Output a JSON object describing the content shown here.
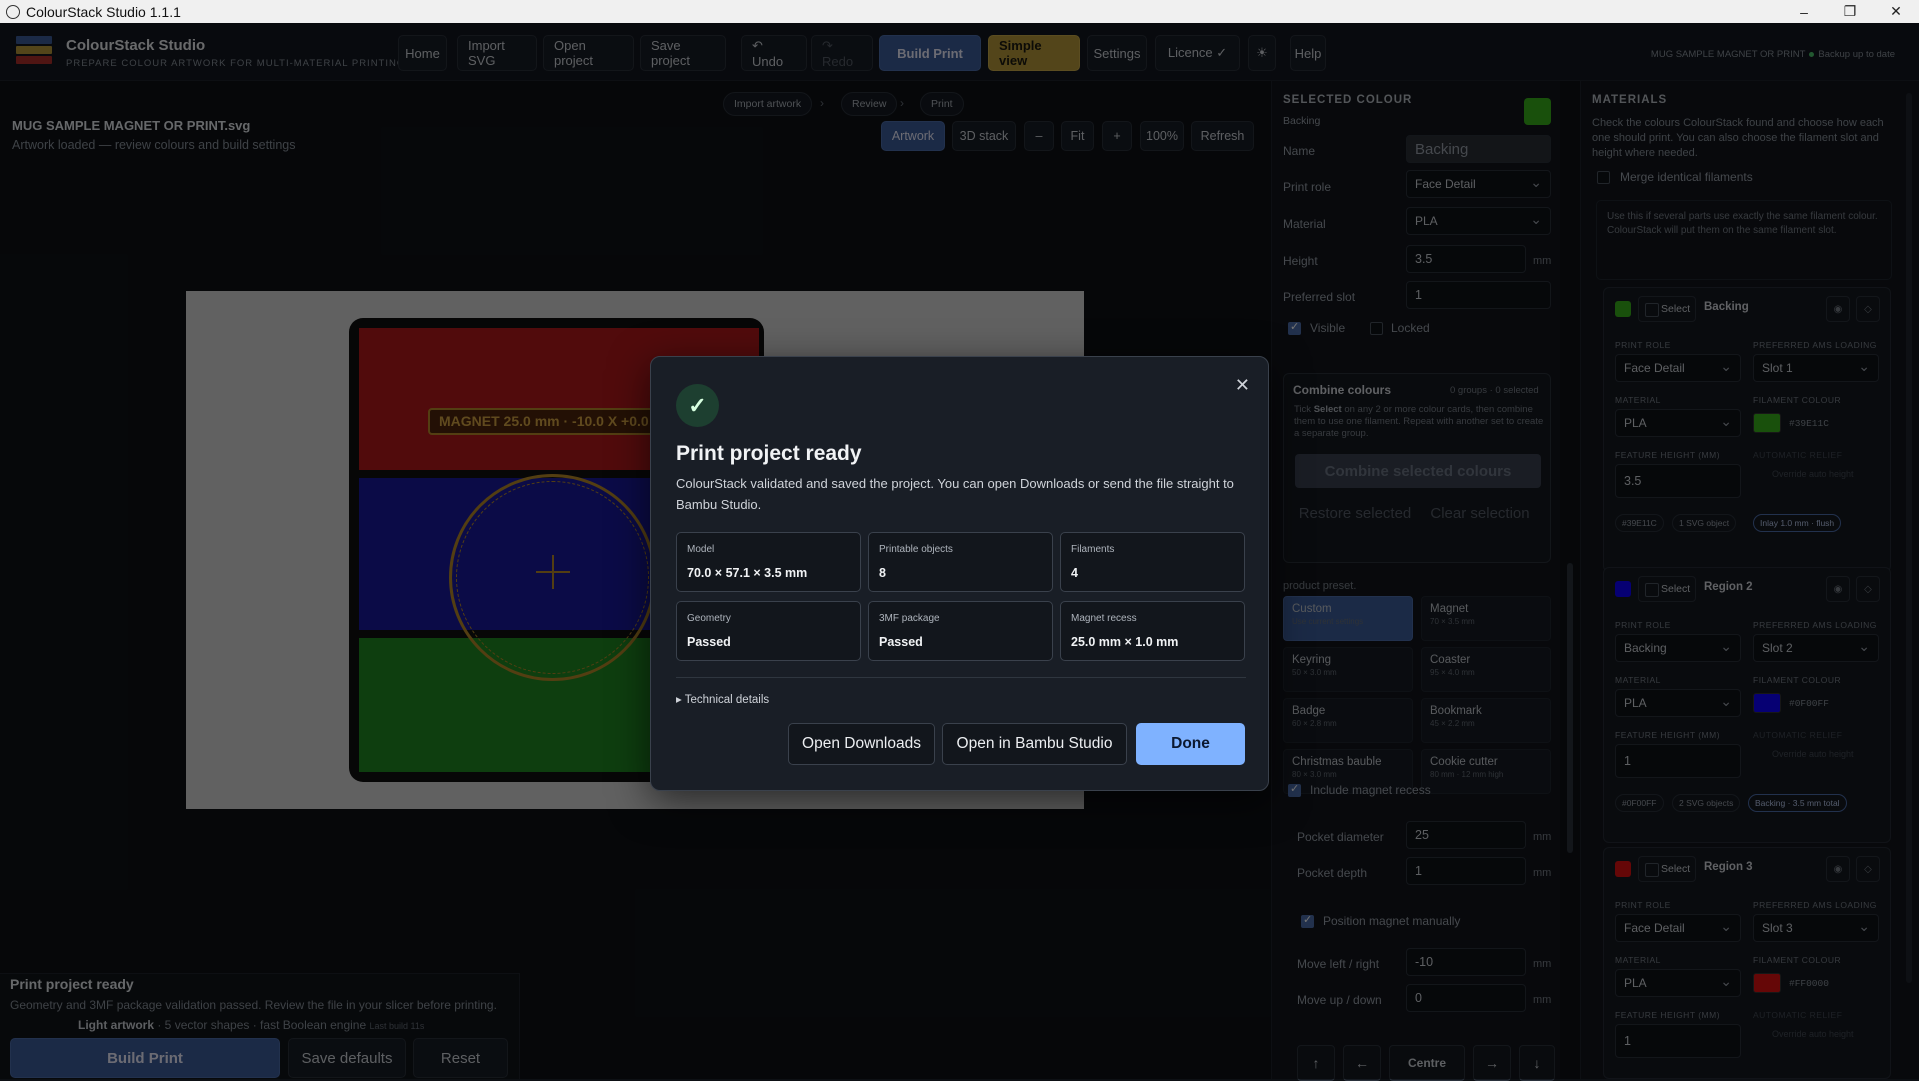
{
  "window": {
    "title": "ColourStack Studio 1.1.1",
    "minimize": "–",
    "maximize": "❐",
    "close": "✕"
  },
  "brand": {
    "name": "ColourStack Studio",
    "tagline": "PREPARE COLOUR ARTWORK FOR MULTI-MATERIAL PRINTING",
    "logo_colors": [
      "#3d5e9b",
      "#b89a3b",
      "#b0302b"
    ]
  },
  "toolbar": {
    "home": "Home",
    "import_svg": "Import SVG",
    "open_project": "Open project",
    "save_project": "Save project",
    "undo": "↶ Undo",
    "redo": "↷ Redo",
    "build_print": "Build Print",
    "simple_view": "Simple view",
    "settings": "Settings",
    "licence": "Licence ✓",
    "theme": "☀",
    "help": "Help",
    "status_file": "MUG SAMPLE MAGNET OR PRINT",
    "status_backup": "Backup up to date"
  },
  "steps": {
    "import": "Import artwork",
    "review": "Review",
    "print": "Print",
    "sep": "›"
  },
  "file": {
    "name": "MUG SAMPLE MAGNET OR PRINT.svg",
    "status": "Artwork loaded — review colours and build settings"
  },
  "view": {
    "artwork": "Artwork",
    "stack3d": "3D stack",
    "minus": "–",
    "fit": "Fit",
    "plus": "+",
    "zoom": "100%",
    "refresh": "Refresh"
  },
  "canvas": {
    "magnet_label": "MAGNET 25.0 mm · -10.0 X  +0.0 Y",
    "bands": [
      "#b3191c",
      "#1a1a9e",
      "#1f8a22"
    ]
  },
  "bottom": {
    "title": "Print project ready",
    "sub": "Geometry and 3MF package validation passed. Review the file in your slicer before printing.",
    "meta_bold": "Light artwork",
    "meta": " · 5 vector shapes · fast Boolean engine",
    "meta_small": "Last build 11s",
    "build": "Build Print",
    "save_defaults": "Save defaults",
    "reset": "Reset"
  },
  "selected": {
    "header": "SELECTED COLOUR",
    "sub": "Backing",
    "swatch": "#39b11c",
    "name_label": "Name",
    "name_value": "Backing",
    "role_label": "Print role",
    "role_value": "Face Detail",
    "material_label": "Material",
    "material_value": "PLA",
    "height_label": "Height",
    "height_value": "3.5",
    "unit_mm": "mm",
    "slot_label": "Preferred slot",
    "slot_value": "1",
    "visible": "Visible",
    "locked": "Locked",
    "combine_title": "Combine colours",
    "combine_count": "0 groups · 0 selected",
    "combine_help_pre": "Tick ",
    "combine_help_bold": "Select",
    "combine_help_post": " on any 2 or more colour cards, then combine them to use one filament. Repeat with another set to create a separate group.",
    "combine_btn": "Combine selected colours",
    "restore": "Restore selected",
    "clear": "Clear selection",
    "preset_hint": "product preset.",
    "presets": [
      {
        "name": "Custom",
        "sub": "Use current settings"
      },
      {
        "name": "Magnet",
        "sub": "70 × 3.5 mm"
      },
      {
        "name": "Keyring",
        "sub": "50 × 3.0 mm"
      },
      {
        "name": "Coaster",
        "sub": "95 × 4.0 mm"
      },
      {
        "name": "Badge",
        "sub": "60 × 2.8 mm"
      },
      {
        "name": "Bookmark",
        "sub": "45 × 2.2 mm"
      },
      {
        "name": "Christmas bauble",
        "sub": "80 × 3.0 mm"
      },
      {
        "name": "Cookie cutter",
        "sub": "80 mm · 12 mm high"
      }
    ],
    "include_magnet": "Include magnet recess",
    "pocket_diam_label": "Pocket diameter",
    "pocket_diam": "25",
    "pocket_depth_label": "Pocket depth",
    "pocket_depth": "1",
    "pos_manual": "Position magnet manually",
    "move_lr_label": "Move left / right",
    "move_lr": "-10",
    "move_ud_label": "Move up / down",
    "move_ud": "0",
    "arrows": {
      "up": "↑",
      "left": "←",
      "centre": "Centre",
      "right": "→",
      "down": "↓"
    }
  },
  "materials": {
    "header": "MATERIALS",
    "help": "Check the colours ColourStack found and choose how each one should print. You can also choose the filament slot and height where needed.",
    "merge": "Merge identical filaments",
    "merge_help": "Use this if several parts use exactly the same filament colour. ColourStack will put them on the same filament slot.",
    "labels": {
      "role": "PRINT ROLE",
      "ams": "PREFERRED AMS LOADING",
      "material": "MATERIAL",
      "fcolour": "FILAMENT COLOUR",
      "feature": "FEATURE HEIGHT (MM)",
      "relief": "AUTOMATIC RELIEF",
      "override": "Override auto height",
      "select": "Select"
    },
    "cards": [
      {
        "swatch": "#39b11c",
        "name": "Backing",
        "role": "Face Detail",
        "slot": "Slot 1",
        "material": "PLA",
        "hex": "#39E11C",
        "height": "3.5",
        "pills": [
          "#39E11C",
          "1 SVG object"
        ],
        "hl": "Inlay 1.0 mm · flush"
      },
      {
        "swatch": "#0f00ff",
        "name": "Region 2",
        "role": "Backing",
        "slot": "Slot 2",
        "material": "PLA",
        "hex": "#0F00FF",
        "height": "1",
        "pills": [
          "#0F00FF",
          "2 SVG objects"
        ],
        "hl": "Backing · 3.5 mm total"
      },
      {
        "swatch": "#ff0000",
        "name": "Region 3",
        "role": "Face Detail",
        "slot": "Slot 3",
        "material": "PLA",
        "hex": "#FF0000",
        "height": "1",
        "pills": [],
        "hl": ""
      }
    ],
    "icon_eye": "◉",
    "icon_diamond": "◇"
  },
  "modal": {
    "check": "✓",
    "close": "✕",
    "title": "Print project ready",
    "body": "ColourStack validated and saved the project. You can open Downloads or send the file straight to Bambu Studio.",
    "stats": [
      {
        "label": "Model",
        "value": "70.0 × 57.1 × 3.5 mm"
      },
      {
        "label": "Printable objects",
        "value": "8"
      },
      {
        "label": "Filaments",
        "value": "4"
      },
      {
        "label": "Geometry",
        "value": "Passed"
      },
      {
        "label": "3MF package",
        "value": "Passed"
      },
      {
        "label": "Magnet recess",
        "value": "25.0 mm × 1.0 mm"
      }
    ],
    "technical": "▸ Technical details",
    "open_downloads": "Open Downloads",
    "open_bambu": "Open in Bambu Studio",
    "done": "Done"
  }
}
